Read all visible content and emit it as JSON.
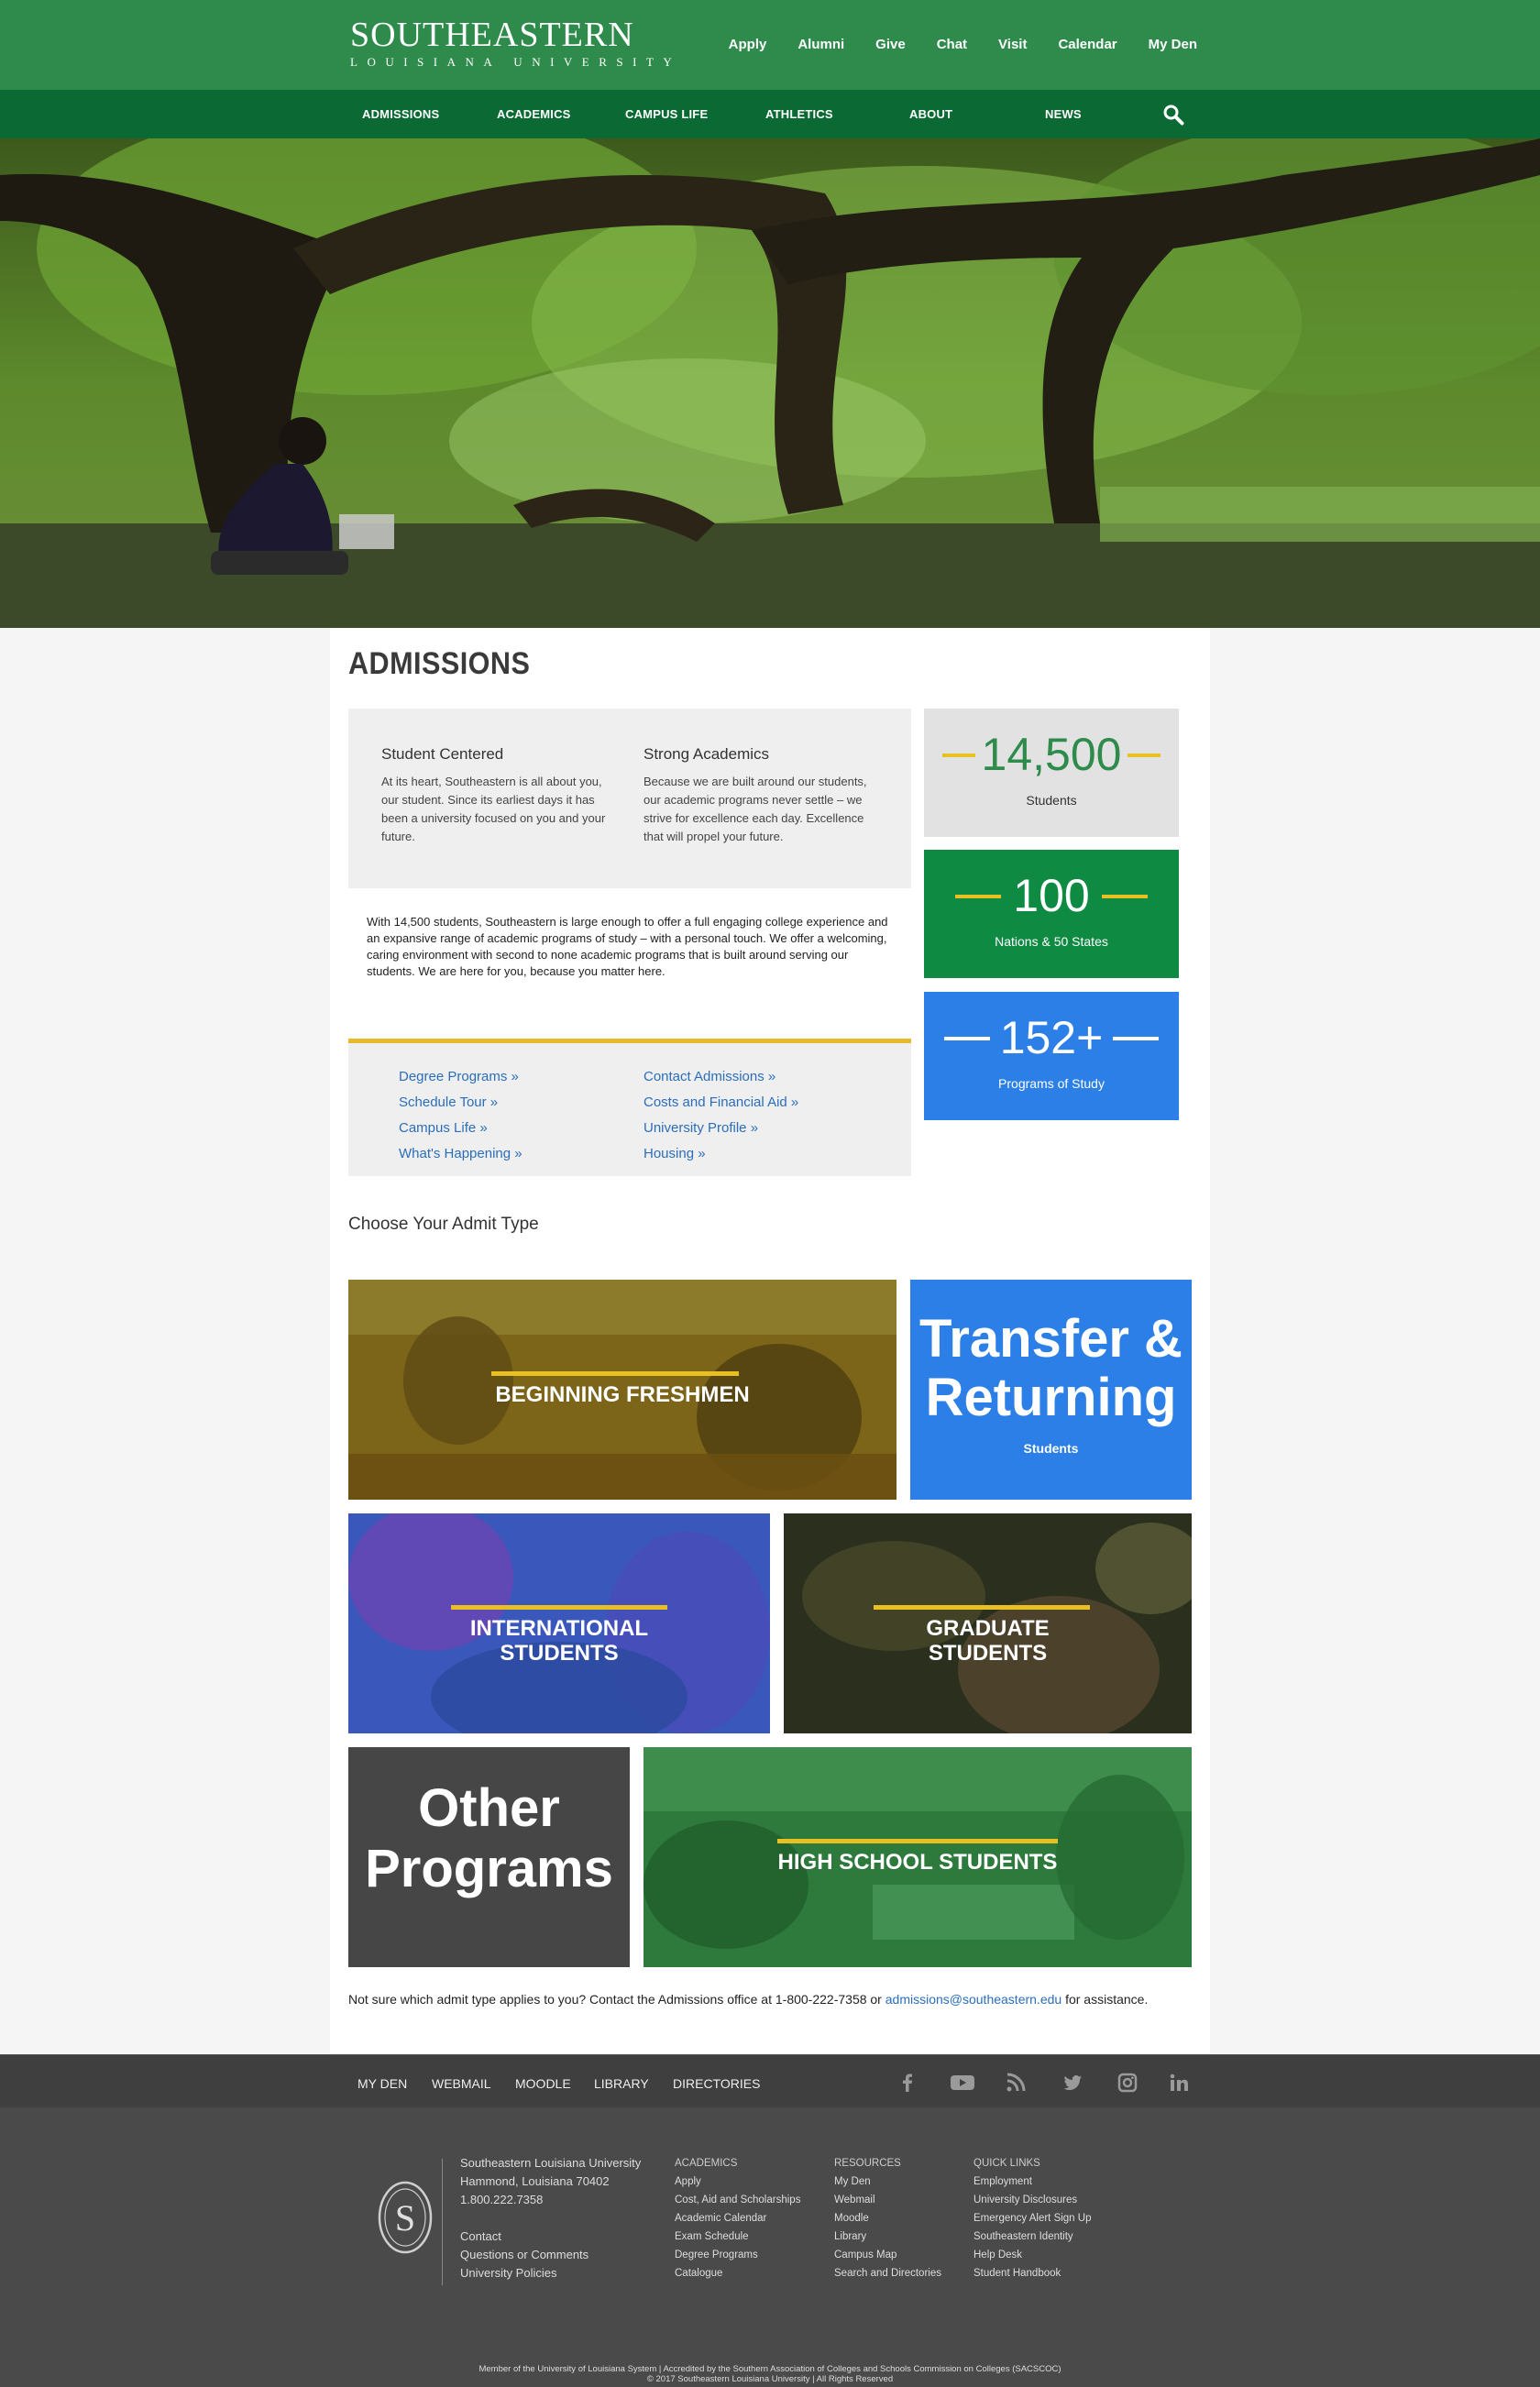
{
  "header": {
    "logo_main": "SOUTHEASTERN",
    "logo_sub": "LOUISIANA UNIVERSITY",
    "utility_links": [
      "Apply",
      "Alumni",
      "Give",
      "Chat",
      "Visit",
      "Calendar",
      "My Den"
    ],
    "nav": [
      "ADMISSIONS",
      "ACADEMICS",
      "CAMPUS LIFE",
      "ATHLETICS",
      "ABOUT",
      "NEWS"
    ],
    "brand_green": "#2e8b4b",
    "nav_green": "#0b6a33"
  },
  "page": {
    "title": "ADMISSIONS",
    "col1_title": "Student Centered",
    "col1_text": "At its heart, Southeastern is all about you, our student. Since its earliest days it has been a university focused on you and your future.",
    "col2_title": "Strong Academics",
    "col2_text": "Because we are built around our students, our academic programs never settle – we strive for excellence each day. Excellence that will propel your future.",
    "paragraph": "With 14,500 students, Southeastern is large enough to offer a full engaging college experience and an expansive range of academic programs of study – with a personal touch. We offer a welcoming, caring environment with second to none academic programs that is built around serving our students. We are here for you, because you matter here.",
    "links_left": [
      "Degree Programs »",
      "Schedule Tour »",
      "Campus Life »",
      "What's Happening »"
    ],
    "links_right": [
      "Contact Admissions »",
      "Costs and Financial Aid »",
      "University Profile »",
      "Housing »"
    ],
    "stats": [
      {
        "value": "14,500",
        "label": "Students"
      },
      {
        "value": "100",
        "label": "Nations & 50 States"
      },
      {
        "value": "152+",
        "label": "Programs of Study"
      }
    ],
    "admit_heading": "Choose Your Admit Type",
    "tiles": {
      "freshmen": "BEGINNING FRESHMEN",
      "transfer_1": "Transfer &",
      "transfer_2": "Returning",
      "transfer_sub": "Students",
      "international_1": "INTERNATIONAL",
      "international_2": "STUDENTS",
      "graduate_1": "GRADUATE",
      "graduate_2": "STUDENTS",
      "other_1": "Other",
      "other_2": "Programs",
      "highschool": "HIGH SCHOOL STUDENTS"
    },
    "contact_before": "Not sure which admit type applies to you? Contact the Admissions office at 1-800-222-7358 or",
    "contact_email": "admissions@southeastern.edu",
    "contact_after": "for assistance."
  },
  "footer": {
    "bar_links": [
      "MY DEN",
      "WEBMAIL",
      "MOODLE",
      "LIBRARY",
      "DIRECTORIES"
    ],
    "social_icons": [
      "facebook-icon",
      "youtube-icon",
      "rss-icon",
      "twitter-icon",
      "instagram-icon",
      "linkedin-icon"
    ],
    "address": [
      "Southeastern Louisiana University",
      "Hammond, Louisiana 70402",
      "1.800.222.7358",
      "",
      "Contact",
      "Questions or Comments",
      "University Policies"
    ],
    "academics": [
      "ACADEMICS",
      "Apply",
      "Cost, Aid and Scholarships",
      "Academic Calendar",
      "Exam Schedule",
      "Degree Programs",
      "Catalogue"
    ],
    "resources": [
      "RESOURCES",
      "My Den",
      "Webmail",
      "Moodle",
      "Library",
      "Campus Map",
      "Search and Directories"
    ],
    "quick_links": [
      "QUICK LINKS",
      "Employment",
      "University Disclosures",
      "Emergency Alert Sign Up",
      "Southeastern Identity",
      "Help Desk",
      "Student Handbook"
    ],
    "bottom_1": "Member of the University of Louisiana System  |  Accredited by the Southern Association of Colleges and Schools Commission on Colleges (SACSCOC)",
    "bottom_2": "© 2017 Southeastern Louisiana University  |  All Rights Reserved"
  }
}
